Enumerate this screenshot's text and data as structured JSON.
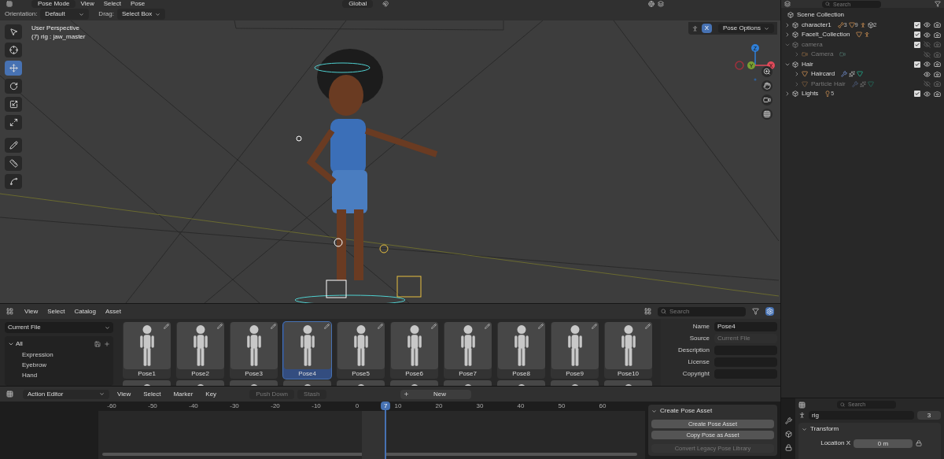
{
  "header": {
    "mode": "Pose Mode",
    "menus": [
      "View",
      "Select",
      "Pose"
    ],
    "transform_orientation": "Global"
  },
  "tool_settings": {
    "orientation_label": "Orientation:",
    "orientation": "Default",
    "drag_label": "Drag:",
    "drag": "Select Box",
    "x_mirror": "X",
    "x_mirror_on": true,
    "pose_options": "Pose Options"
  },
  "tools": [
    {
      "kind": "select",
      "selected": false
    },
    {
      "kind": "cursor",
      "selected": false
    },
    {
      "kind": "move",
      "selected": true
    },
    {
      "kind": "rotate",
      "selected": false
    },
    {
      "kind": "scale",
      "selected": false
    },
    {
      "kind": "transform",
      "selected": false
    },
    {
      "kind": "annotate",
      "selected": false
    },
    {
      "kind": "measure",
      "selected": false
    },
    {
      "kind": "bone",
      "selected": false
    }
  ],
  "viewport": {
    "perspective": "User Perspective",
    "active": "(7) rig : jaw_master",
    "gizmo": [
      "Z",
      "Y",
      "X"
    ]
  },
  "outliner": {
    "search_placeholder": "Search",
    "root": "Scene Collection",
    "items": [
      {
        "label": "character1",
        "kind": "collection",
        "expanded": false,
        "dimmed": false,
        "checked": true,
        "visible": true,
        "contents": [
          {
            "kind": "armature",
            "count": "3"
          },
          {
            "kind": "mesh",
            "count": "9"
          },
          {
            "kind": "pose"
          },
          {
            "kind": "collection",
            "count": "2"
          }
        ]
      },
      {
        "label": "Facelt_Collection",
        "kind": "collection",
        "expanded": false,
        "dimmed": false,
        "checked": true,
        "visible": true,
        "contents": [
          {
            "kind": "mesh"
          },
          {
            "kind": "pose"
          }
        ]
      },
      {
        "label": "camera",
        "kind": "collection",
        "expanded": true,
        "dimmed": true,
        "checked": true,
        "visible": false,
        "children": [
          {
            "label": "Camera",
            "kind": "camera",
            "expanded": false,
            "dimmed": true,
            "visible": false,
            "contents": [
              {
                "kind": "camera_data"
              }
            ]
          }
        ]
      },
      {
        "label": "Hair",
        "kind": "collection",
        "expanded": true,
        "dimmed": false,
        "checked": true,
        "visible": true,
        "children": [
          {
            "label": "Haircard",
            "kind": "mesh",
            "expanded": false,
            "dimmed": false,
            "visible": true,
            "contents": [
              {
                "kind": "modifier"
              },
              {
                "kind": "particles"
              },
              {
                "kind": "mesh_data"
              }
            ]
          },
          {
            "label": "Particle Hair",
            "kind": "mesh",
            "expanded": false,
            "dimmed": true,
            "visible": false,
            "contents": [
              {
                "kind": "modifier"
              },
              {
                "kind": "particles"
              },
              {
                "kind": "mesh_data"
              }
            ]
          }
        ]
      },
      {
        "label": "Lights",
        "kind": "collection",
        "expanded": false,
        "dimmed": false,
        "checked": true,
        "visible": true,
        "contents": [
          {
            "kind": "light",
            "count": "5"
          }
        ]
      }
    ]
  },
  "asset_browser": {
    "menus": [
      "View",
      "Select",
      "Catalog",
      "Asset"
    ],
    "library": "Current File",
    "search_placeholder": "Search",
    "catalog": {
      "label": "All",
      "expanded": true,
      "children": [
        "Expression",
        "Eyebrow",
        "Hand"
      ]
    },
    "assets": [
      {
        "name": "Pose1",
        "selected": false
      },
      {
        "name": "Pose2",
        "selected": false
      },
      {
        "name": "Pose3",
        "selected": false
      },
      {
        "name": "Pose4",
        "selected": true
      },
      {
        "name": "Pose5",
        "selected": false
      },
      {
        "name": "Pose6",
        "selected": false
      },
      {
        "name": "Pose7",
        "selected": false
      },
      {
        "name": "Pose8",
        "selected": false
      },
      {
        "name": "Pose9",
        "selected": false
      },
      {
        "name": "Pose10",
        "selected": false
      }
    ],
    "fields": [
      {
        "label": "Name",
        "value": "Pose4",
        "disabled": false
      },
      {
        "label": "Source",
        "value": "Current File",
        "disabled": true
      },
      {
        "label": "Description",
        "disabled": false
      },
      {
        "label": "License",
        "disabled": false
      },
      {
        "label": "Copyright",
        "disabled": false
      }
    ]
  },
  "action_editor": {
    "mode": "Action Editor",
    "menus": [
      "View",
      "Select",
      "Marker",
      "Key"
    ],
    "push_down": "Push Down",
    "stash": "Stash",
    "new": "New",
    "frames": [
      "-60",
      "-50",
      "-40",
      "-30",
      "-20",
      "-10",
      "0",
      "10",
      "20",
      "30",
      "40",
      "50",
      "60"
    ],
    "current_frame": "7",
    "panel": {
      "title": "Create Pose Asset",
      "buttons": [
        {
          "label": "Create Pose Asset",
          "disabled": false
        },
        {
          "label": "Copy Pose as Asset",
          "disabled": false
        },
        {
          "label": "Convert Legacy Pose Library",
          "disabled": true
        }
      ]
    }
  },
  "properties": {
    "search_placeholder": "Search",
    "object": "rig",
    "users": "3",
    "panel": "Transform",
    "row_label": "Location X",
    "row_value": "0 m"
  }
}
